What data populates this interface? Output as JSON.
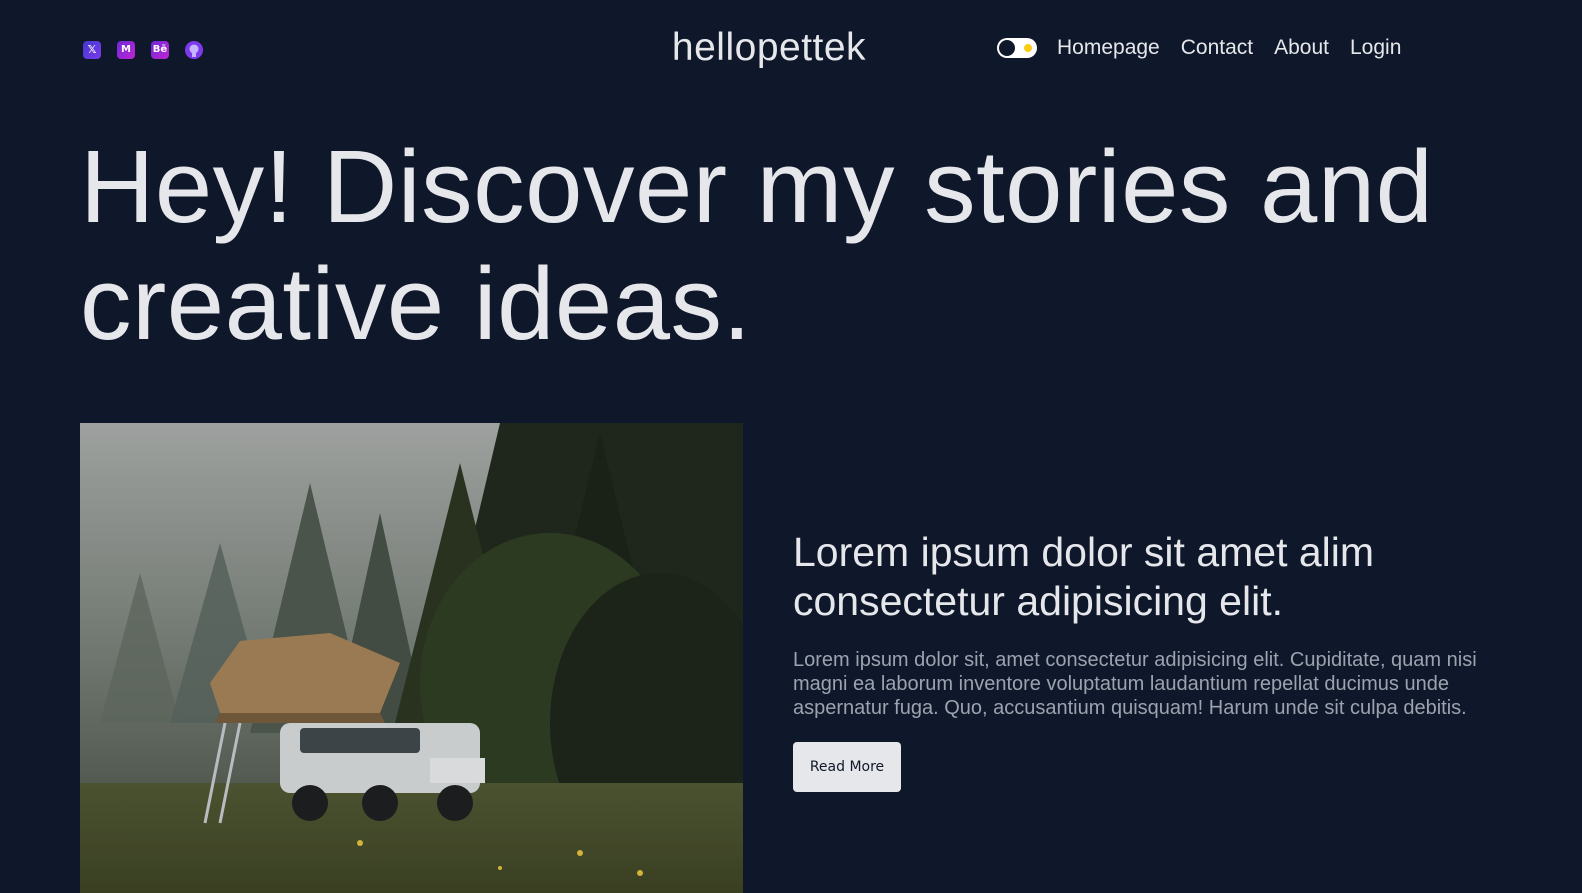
{
  "header": {
    "logo": "hellopettek",
    "social": [
      {
        "icon": "x-twitter-icon",
        "glyph": "𝕏"
      },
      {
        "icon": "medium-icon",
        "glyph": "M"
      },
      {
        "icon": "behance-icon",
        "glyph": "Bē"
      },
      {
        "icon": "github-icon",
        "glyph": "●"
      }
    ],
    "nav": [
      "Homepage",
      "Contact",
      "About",
      "Login"
    ],
    "theme_toggle": {
      "state": "dark"
    }
  },
  "hero": {
    "title": "Hey! Discover my stories and creative ideas."
  },
  "featured_post": {
    "image_alt": "Off-road vehicle with rooftop tent in a foggy forest",
    "title": "Lorem ipsum dolor sit amet alim consectetur adipisicing elit.",
    "description": "Lorem ipsum dolor sit, amet consectetur adipisicing elit. Cupiditate, quam nisi magni ea laborum inventore voluptatum laudantium repellat ducimus unde aspernatur fuga. Quo, accusantium quisquam! Harum unde sit culpa debitis.",
    "button": "Read More"
  },
  "colors": {
    "background": "#0f172a",
    "text": "#e5e7eb",
    "muted": "#9ca3af",
    "accent": "#7c3aed"
  }
}
